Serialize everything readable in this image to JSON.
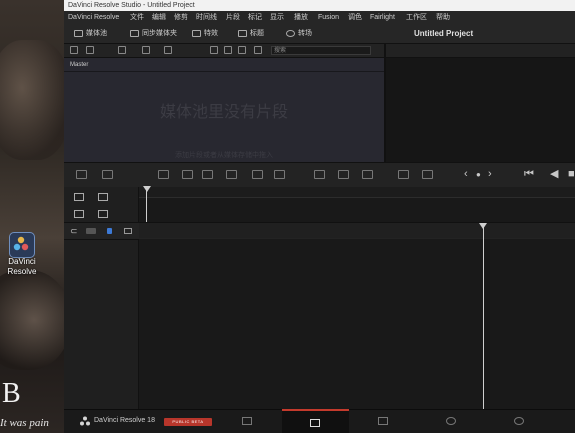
{
  "desktop": {
    "icon_label": "DaVinci Resolve",
    "wallpaper_big_text": "B ",
    "wallpaper_small_text": "It was pain"
  },
  "window": {
    "title": "DaVinci Resolve Studio - Untitled Project"
  },
  "menu": [
    "DaVinci Resolve",
    "文件",
    "编辑",
    "修剪",
    "时间线",
    "片段",
    "标记",
    "显示",
    "播放",
    "Fusion",
    "调色",
    "Fairlight",
    "工作区",
    "帮助"
  ],
  "toolbar": {
    "media_pool": "媒体池",
    "sync_bin": "同步媒体夹",
    "effects": "特效",
    "titles": "标题",
    "transitions": "转场",
    "project_title": "Untitled Project"
  },
  "search": {
    "placeholder": "搜索"
  },
  "media_pool": {
    "bin": "Master",
    "empty_text": "媒体池里没有片段",
    "empty_hint": "添加片段或者从媒体存储中拖入"
  },
  "bottom": {
    "app_name": "DaVinci Resolve 18",
    "badge": "PUBLIC BETA",
    "pages": [
      "media",
      "cut",
      "edit",
      "fusion",
      "color",
      "fairlight"
    ],
    "active_page": "cut"
  },
  "colors": {
    "accent": "#c43a2c",
    "badge": "#b8362b",
    "panel": "#282830"
  }
}
